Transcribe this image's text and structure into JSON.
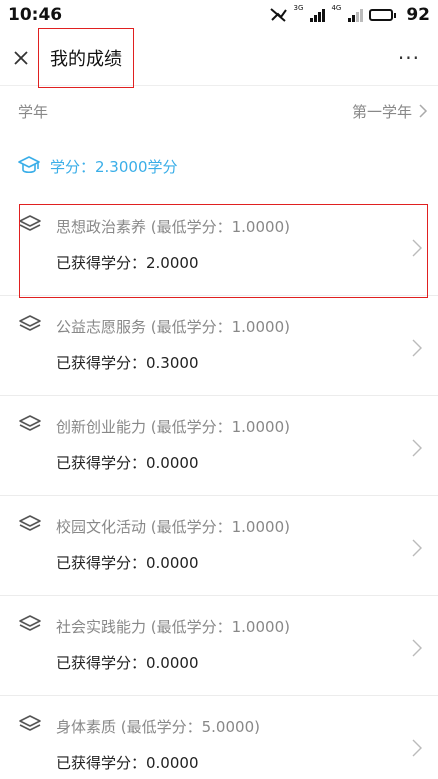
{
  "status_bar": {
    "time": "10:46",
    "signal1_label": "3G",
    "signal2_label": "4G",
    "battery": "92"
  },
  "nav": {
    "title": "我的成绩",
    "close_icon": "close-icon",
    "more_label": "···"
  },
  "year": {
    "label": "学年",
    "value": "第一学年"
  },
  "credit_summary": "学分：2.3000学分",
  "items": [
    {
      "name": "思想政治素养 (最低学分：1.0000)",
      "earned": "已获得学分：2.0000"
    },
    {
      "name": "公益志愿服务 (最低学分：1.0000)",
      "earned": "已获得学分：0.3000"
    },
    {
      "name": "创新创业能力 (最低学分：1.0000)",
      "earned": "已获得学分：0.0000"
    },
    {
      "name": "校园文化活动 (最低学分：1.0000)",
      "earned": "已获得学分：0.0000"
    },
    {
      "name": "社会实践能力 (最低学分：1.0000)",
      "earned": "已获得学分：0.0000"
    },
    {
      "name": "身体素质 (最低学分：5.0000)",
      "earned": "已获得学分：0.0000"
    }
  ],
  "colors": {
    "accent": "#3aaee8",
    "highlight": "#e02020"
  }
}
